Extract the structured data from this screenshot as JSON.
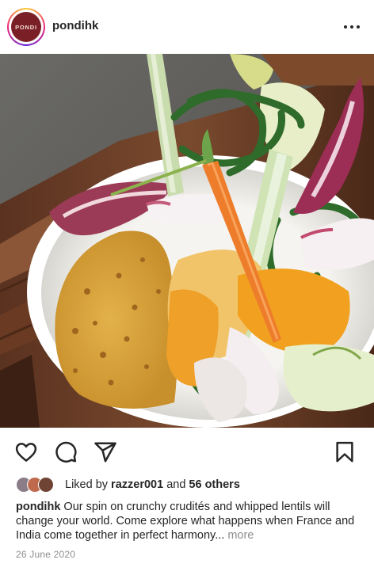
{
  "post": {
    "username": "pondihk",
    "avatar_text": "PONDI",
    "likes_prefix": "Liked by",
    "liked_by_user": "razzer001",
    "likes_joiner": "and",
    "likes_others": "56 others",
    "caption_username": "pondihk",
    "caption_text": "Our spin on crunchy crudités and whipped lentils will change your world. Come explore what happens when France and India come together in perfect harmony...",
    "more_label": "more",
    "date": "26 June 2020"
  },
  "icons": {
    "more": "more-options-icon",
    "like": "heart-icon",
    "comment": "comment-icon",
    "share": "share-icon",
    "save": "bookmark-icon"
  },
  "colors": {
    "avatar_bg": "#7a1f26",
    "text": "#262626",
    "secondary_text": "#8e8e8e"
  }
}
